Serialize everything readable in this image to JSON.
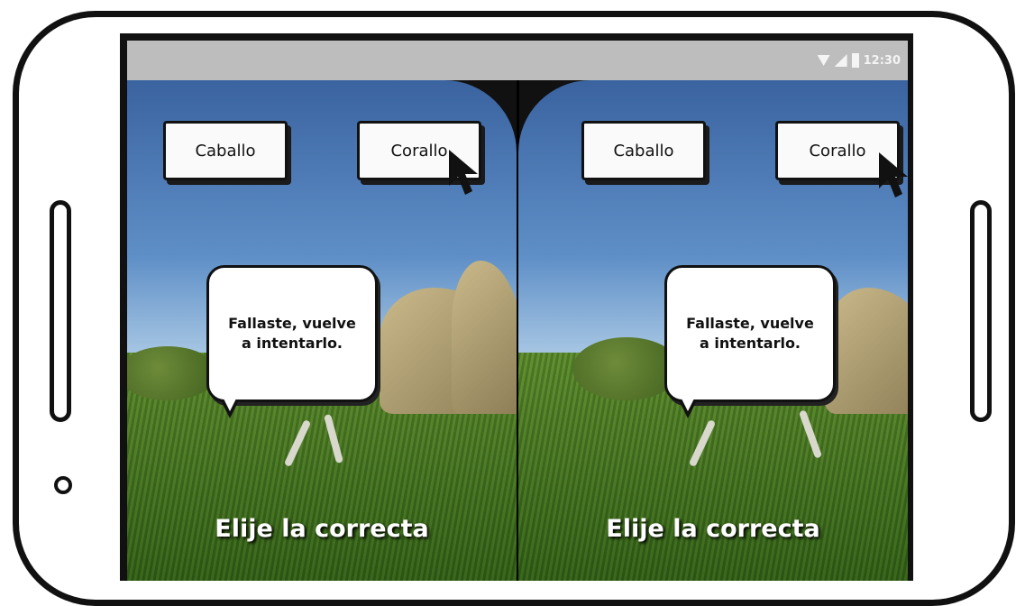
{
  "status_bar": {
    "time": "12:30",
    "icons": [
      "wifi-icon",
      "signal-icon",
      "battery-icon"
    ]
  },
  "views": [
    {
      "id": "left-eye",
      "options": [
        "Caballo",
        "Corallo"
      ],
      "feedback": "Fallaste, vuelve a intentarlo.",
      "prompt": "Elije la correcta"
    },
    {
      "id": "right-eye",
      "options": [
        "Caballo",
        "Corallo"
      ],
      "feedback": "Fallaste, vuelve a intentarlo.",
      "prompt": "Elije la correcta"
    }
  ],
  "colors": {
    "phone_outline": "#111111",
    "status_bar": "#bdbdbd",
    "button_bg": "#fafafa",
    "caption_text": "#ffffff"
  }
}
